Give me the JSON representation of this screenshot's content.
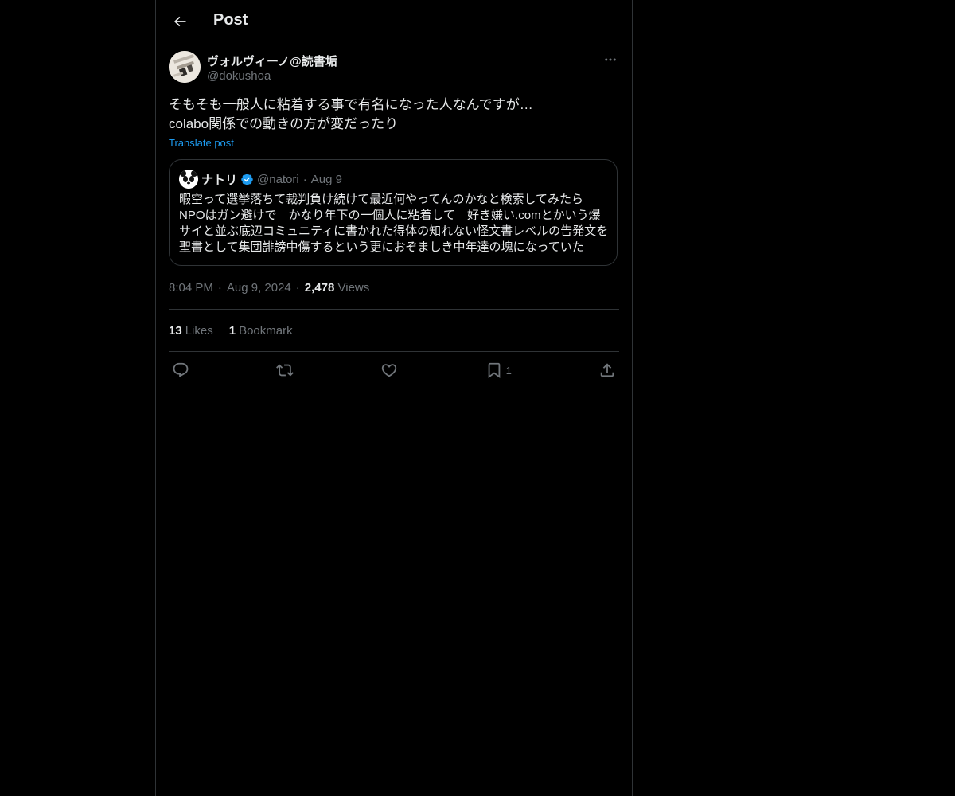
{
  "header": {
    "title": "Post",
    "back_icon": "arrow-left-icon"
  },
  "post": {
    "author_name": "ヴォルヴィーノ@読書垢",
    "author_handle": "@dokushoa",
    "more_icon": "more-horizontal-icon",
    "text_lines": [
      "そもそも一般人に粘着する事で有名になった人なんですが…",
      "colabo関係での動きの方が変だったり"
    ],
    "translate_label": "Translate post",
    "quote": {
      "name": "ナトリ",
      "verified": true,
      "handle": "@natori",
      "dot": "·",
      "date": "Aug 9",
      "text_lines": [
        "暇空って選挙落ちて裁判負け続けて最近何やってんのかなと検索してみたら",
        "NPOはガン避けで　かなり年下の一個人に粘着して　好き嫌い.comとかいう爆",
        "サイと並ぶ底辺コミュニティに書かれた得体の知れない怪文書レベルの告発文を",
        "聖書として集団誹謗中傷するという更におぞましき中年達の塊になっていた"
      ]
    },
    "time": "8:04 PM",
    "sep": "·",
    "date": "Aug 9, 2024",
    "views_count": "2,478",
    "views_label": "Views",
    "likes_count": "13",
    "likes_label": "Likes",
    "bookmarks_count": "1",
    "bookmarks_label": "Bookmark"
  },
  "actions": {
    "reply_icon": "reply-icon",
    "repost_icon": "repost-icon",
    "like_icon": "heart-icon",
    "bookmark_icon": "bookmark-icon",
    "bookmark_count": "1",
    "share_icon": "share-icon"
  },
  "colors": {
    "background": "#000000",
    "text": "#e7e9ea",
    "muted": "#71767b",
    "border": "#2f3336",
    "accent": "#1d9bf0"
  }
}
